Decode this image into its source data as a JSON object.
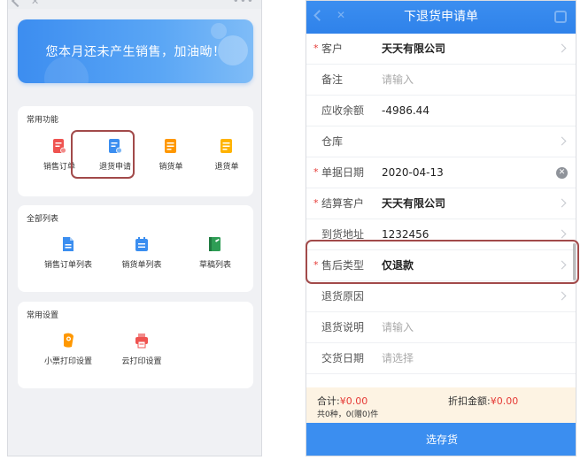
{
  "left": {
    "banner_text": "您本月还未产生销售，加油呦！",
    "sections": [
      {
        "title": "常用功能",
        "items": [
          {
            "label": "销售订单",
            "icon": "sales-order-icon",
            "color": "#ef5350"
          },
          {
            "label": "退货申请",
            "icon": "return-request-icon",
            "color": "#3b8ef0"
          },
          {
            "label": "销货单",
            "icon": "sales-bill-icon",
            "color": "#ff9800"
          },
          {
            "label": "退货单",
            "icon": "return-bill-icon",
            "color": "#ffb300"
          }
        ]
      },
      {
        "title": "全部列表",
        "items": [
          {
            "label": "销售订单列表",
            "icon": "sales-order-list-icon",
            "color": "#3b8ef0"
          },
          {
            "label": "销货单列表",
            "icon": "sales-bill-list-icon",
            "color": "#3b8ef0"
          },
          {
            "label": "草稿列表",
            "icon": "draft-list-icon",
            "color": "#2e9d55"
          }
        ]
      },
      {
        "title": "常用设置",
        "items": [
          {
            "label": "小票打印设置",
            "icon": "receipt-print-settings-icon",
            "color": "#ff9800"
          },
          {
            "label": "云打印设置",
            "icon": "cloud-print-settings-icon",
            "color": "#ef5350"
          }
        ]
      }
    ]
  },
  "right": {
    "title": "下退货申请单",
    "fields": [
      {
        "label": "客户",
        "value": "天天有限公司",
        "required": true,
        "bold": true,
        "chevron": true
      },
      {
        "label": "备注",
        "placeholder": "请输入"
      },
      {
        "label": "应收余额",
        "value": "-4986.44"
      },
      {
        "label": "仓库",
        "value": "",
        "chevron": true
      },
      {
        "label": "单据日期",
        "value": "2020-04-13",
        "required": true,
        "clear": true
      },
      {
        "label": "结算客户",
        "value": "天天有限公司",
        "required": true,
        "bold": true,
        "chevron": true
      },
      {
        "label": "到货地址",
        "value": "1232456",
        "chevron": true
      },
      {
        "label": "售后类型",
        "value": "仅退款",
        "required": true,
        "bold": true,
        "chevron": true
      },
      {
        "label": "退货原因",
        "value": "",
        "chevron": true
      },
      {
        "label": "退货说明",
        "placeholder": "请输入"
      },
      {
        "label": "交货日期",
        "placeholder": "请选择"
      }
    ],
    "summary": {
      "total_label": "合计:",
      "total_value": "¥0.00",
      "discount_label": "折扣金额:",
      "discount_value": "¥0.00",
      "count_text": "共0种，0(赠0)件"
    },
    "bottom_button": "选存货"
  },
  "colors": {
    "primary": "#3b8ef0",
    "required": "#e53935",
    "highlight_border": "#a24a4a",
    "summary_bg": "#fdf3e3"
  }
}
